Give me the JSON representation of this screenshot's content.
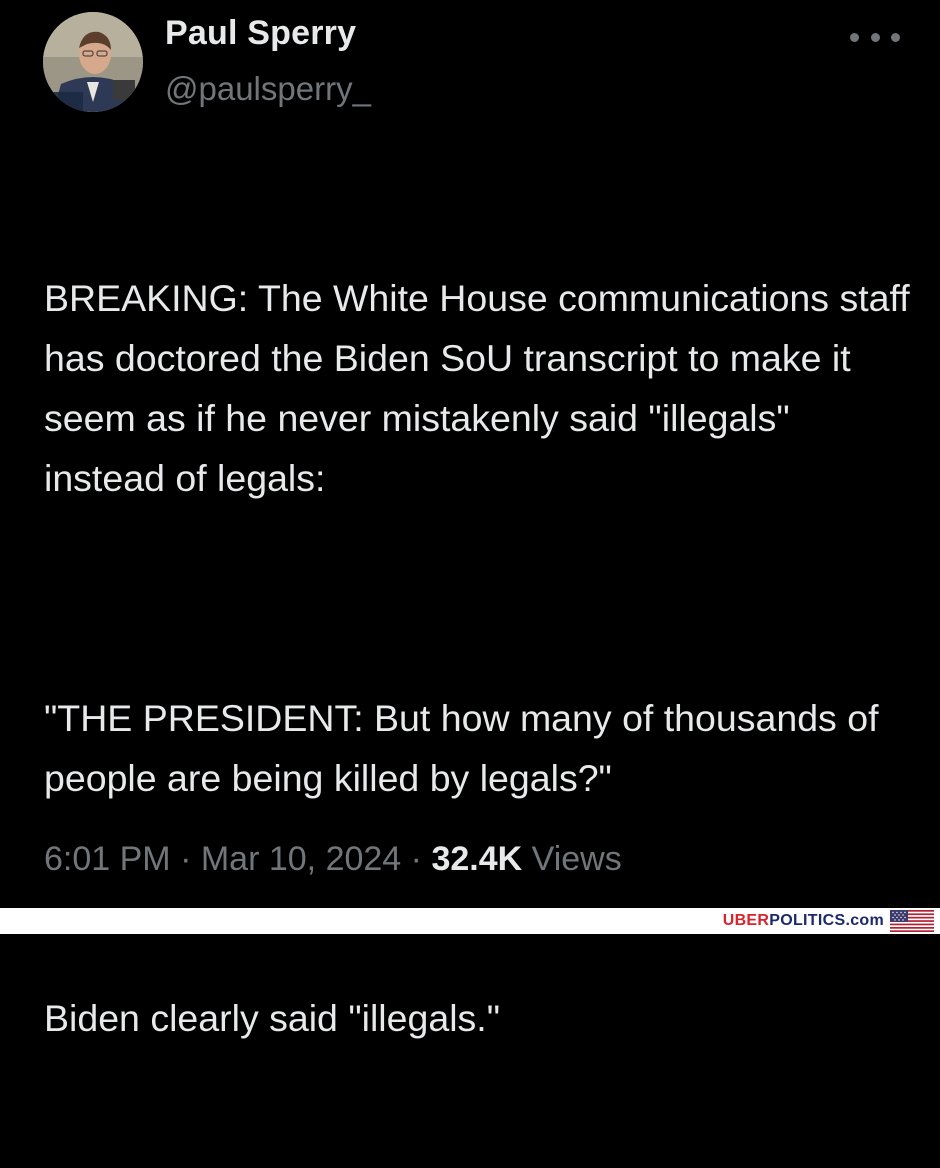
{
  "tweet": {
    "author": {
      "display_name": "Paul Sperry",
      "handle": "@paulsperry_"
    },
    "paragraphs": [
      "BREAKING: The White House communications staff has doctored the Biden SoU transcript to make it seem as if he never mistakenly said \"illegals\" instead of legals:",
      "\"THE PRESIDENT: But how many of thousands of people are being killed by legals?\"",
      "Biden clearly said \"illegals.\""
    ],
    "time": "6:01 PM",
    "separator": "·",
    "date": "Mar 10, 2024",
    "views_count": "32.4K",
    "views_label": "Views",
    "more_icon": "ellipsis-icon"
  },
  "footer": {
    "logo_uber": "UBER",
    "logo_rest": "POLITICS.com",
    "flag_icon": "us-flag-icon"
  },
  "colors": {
    "background": "#000000",
    "primary_text": "#e7e9ea",
    "secondary_text": "#71767b",
    "logo_red": "#d9232d",
    "logo_blue": "#1b2a6b"
  }
}
